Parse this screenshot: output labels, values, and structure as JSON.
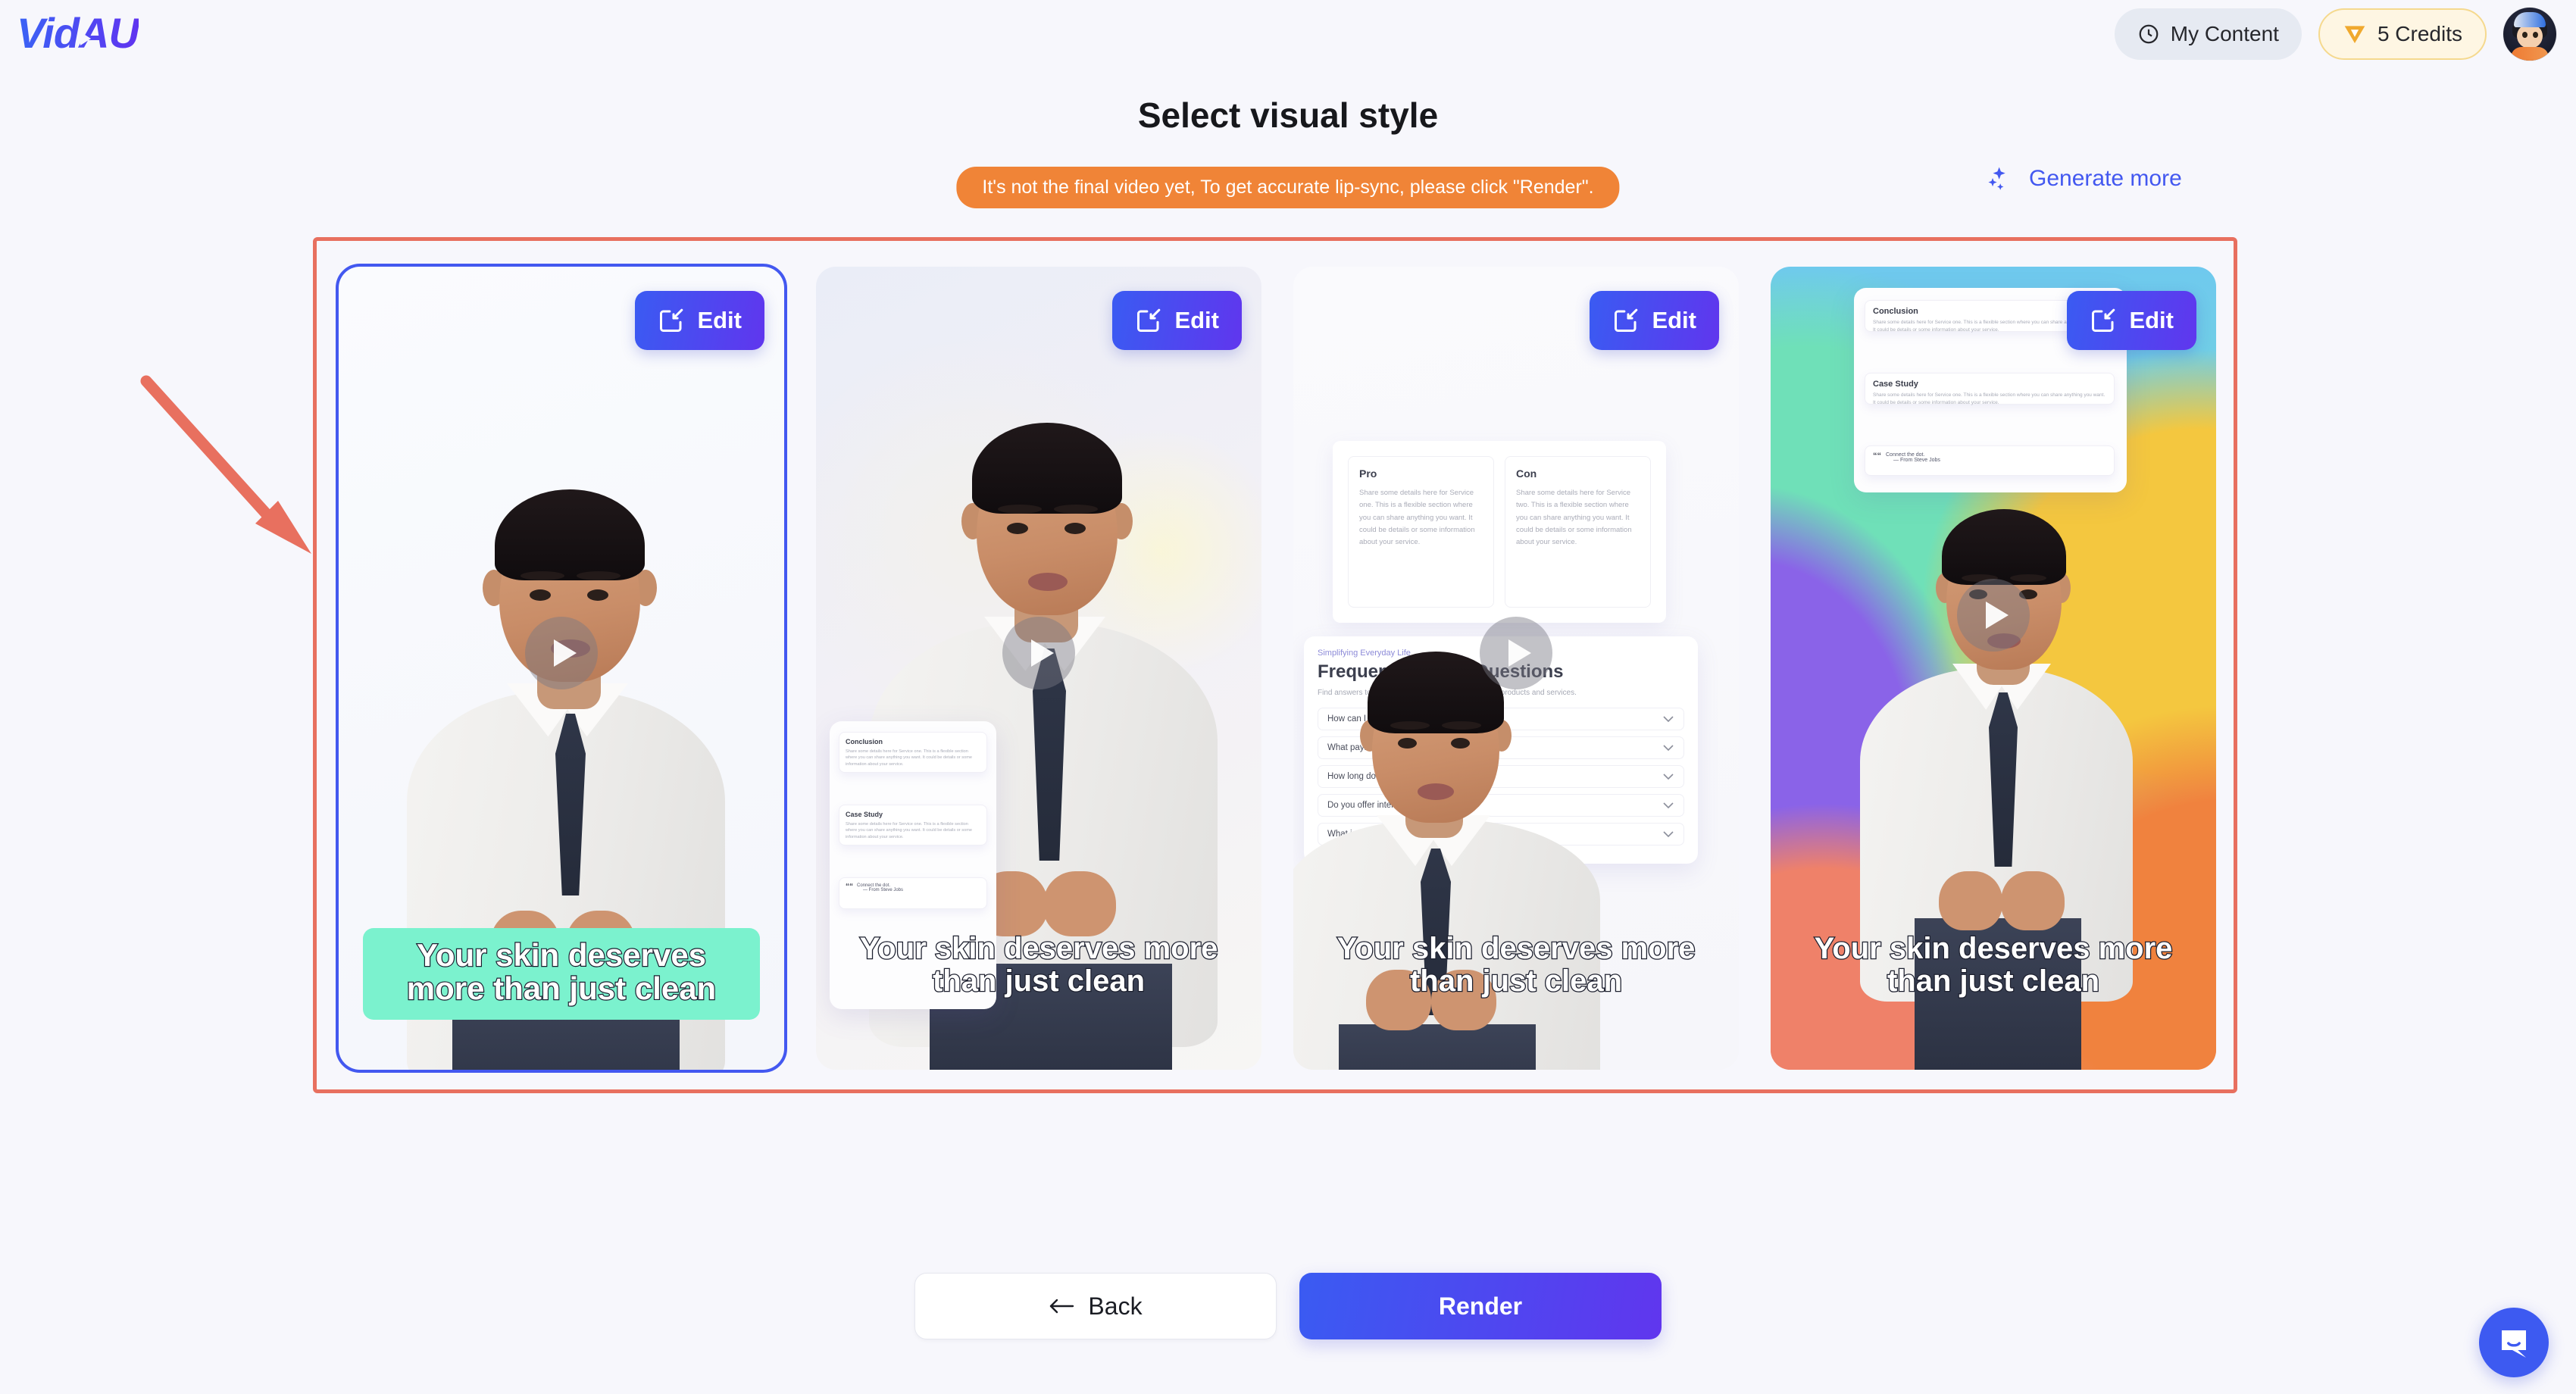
{
  "brand": {
    "name": "VidAU"
  },
  "header": {
    "my_content_label": "My Content",
    "credits_label": "5 Credits",
    "clock_icon": "clock-icon",
    "gem_icon": "gem-icon",
    "avatar_icon": "user-avatar"
  },
  "main": {
    "title": "Select visual style",
    "notice": "It's not the final video yet, To get accurate lip-sync, please click \"Render\".",
    "generate_more_label": "Generate more",
    "sparkle_icon": "sparkles-icon"
  },
  "cards": [
    {
      "edit_label": "Edit",
      "caption": "Your skin deserves more than just clean",
      "selected": true,
      "style": "plain-white",
      "caption_style": "boxed-mint"
    },
    {
      "edit_label": "Edit",
      "caption": "Your skin deserves more than just clean",
      "selected": false,
      "style": "soft-lavender",
      "caption_style": "outlined-white"
    },
    {
      "edit_label": "Edit",
      "caption": "Your skin deserves more than just clean",
      "selected": false,
      "style": "faq-slide",
      "caption_style": "outlined-white"
    },
    {
      "edit_label": "Edit",
      "caption": "Your skin deserves more than just clean",
      "selected": false,
      "style": "colorful-gradient",
      "caption_style": "outlined-white"
    }
  ],
  "slide_doc": {
    "conclusion_heading": "Conclusion",
    "conclusion_body": "Share some details here for Service one. This is a flexible section where you can share anything you want. It could be details or some information about your service.",
    "case_study_heading": "Case Study",
    "case_study_body": "Share some details here for Service one. This is a flexible section where you can share anything you want. It could be details or some information about your service.",
    "quote_text": "Connect the dot.",
    "quote_author": "— From Steve Jobs"
  },
  "faq_slide": {
    "pro_heading": "Pro",
    "pro_body": "Share some details here for Service one. This is a flexible section where you can share anything you want. It could be details or some information about your service.",
    "con_heading": "Con",
    "con_body": "Share some details here for Service two. This is a flexible section where you can share anything you want. It could be details or some information about your service.",
    "kicker": "Simplifying Everyday Life",
    "title": "Frequently Asked Questions",
    "subtitle": "Find answers to commonly asked questions about our products and services.",
    "items": [
      "How can I place an order?",
      "What payment methods do you accept?",
      "How long does delivery take?",
      "Do you offer international shipping?",
      "What is your return policy?"
    ]
  },
  "footer": {
    "back_label": "Back",
    "render_label": "Render"
  },
  "chat": {
    "icon": "chat-bubble-icon"
  },
  "colors": {
    "accent_blue": "#4358F0",
    "accent_purple": "#6036EE",
    "notice_orange": "#F08437",
    "annotation_red": "#E8705F",
    "caption_mint": "#7BF2CE",
    "credits_gold": "#F0A92E"
  }
}
